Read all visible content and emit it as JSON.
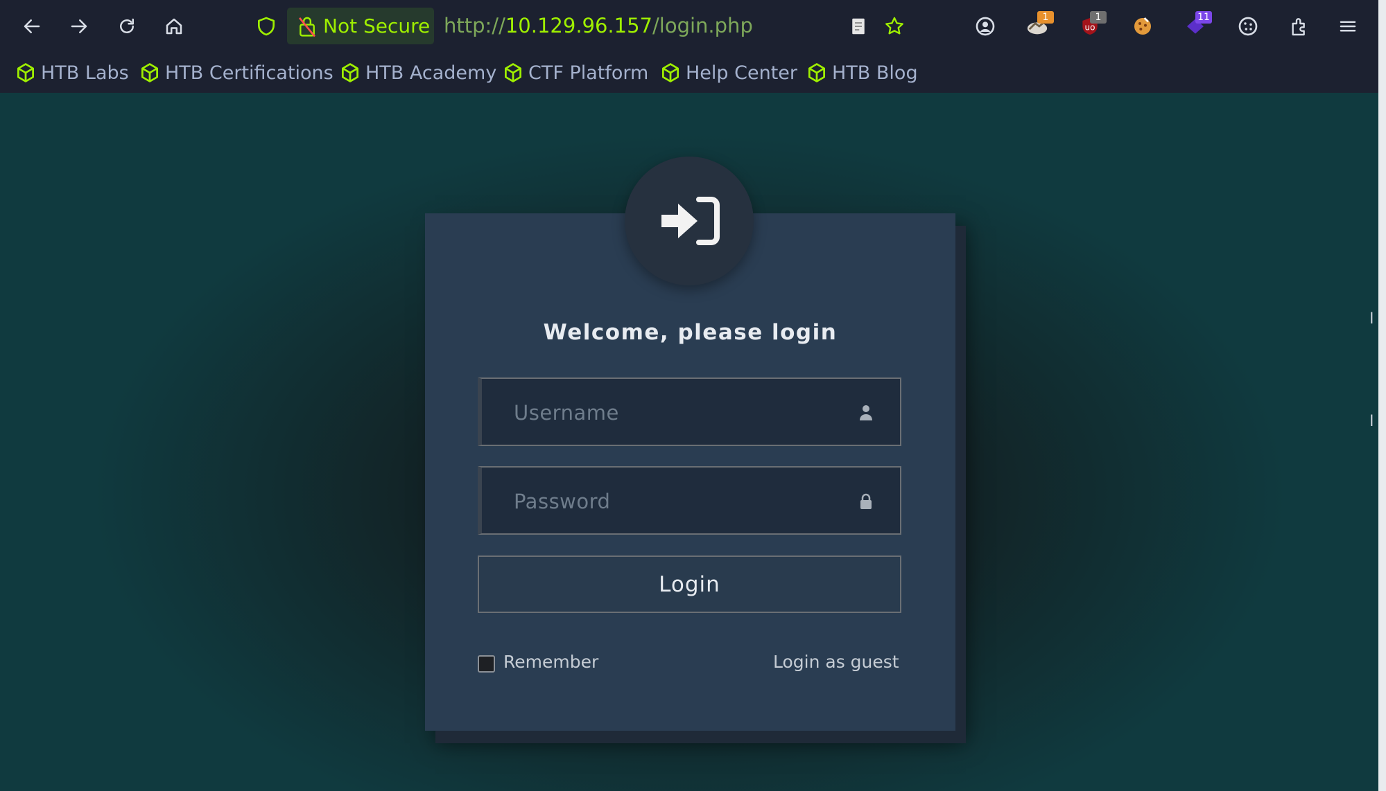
{
  "browser": {
    "nav": {
      "back_icon": "arrow-left-icon",
      "forward_icon": "arrow-right-icon",
      "reload_icon": "reload-icon",
      "home_icon": "home-icon"
    },
    "security_label": "Not Secure",
    "url_scheme": "http://",
    "url_host": "10.129.96.157",
    "url_path": "/login.php",
    "extensions": [
      {
        "name": "reader-view-icon"
      },
      {
        "name": "bookmark-star-icon"
      },
      {
        "name": "account-icon"
      },
      {
        "name": "extension-hacker-icon",
        "badge": "1"
      },
      {
        "name": "ublock-icon",
        "badge": "1"
      },
      {
        "name": "cookie-extension-icon"
      },
      {
        "name": "purple-extension-icon",
        "badge": "11"
      },
      {
        "name": "cookies-icon"
      },
      {
        "name": "extensions-icon"
      },
      {
        "name": "menu-icon"
      }
    ],
    "bookmarks": [
      "HTB Labs",
      "HTB Certifications",
      "HTB Academy",
      "CTF Platform",
      "Help Center",
      "HTB Blog"
    ]
  },
  "login": {
    "title": "Welcome, please login",
    "username_placeholder": "Username",
    "password_placeholder": "Password",
    "login_button": "Login",
    "remember_label": "Remember",
    "guest_link": "Login as guest"
  },
  "colors": {
    "accent": "#9fef00",
    "chrome_bg": "#1c2130",
    "card_bg": "#2a3d52"
  }
}
